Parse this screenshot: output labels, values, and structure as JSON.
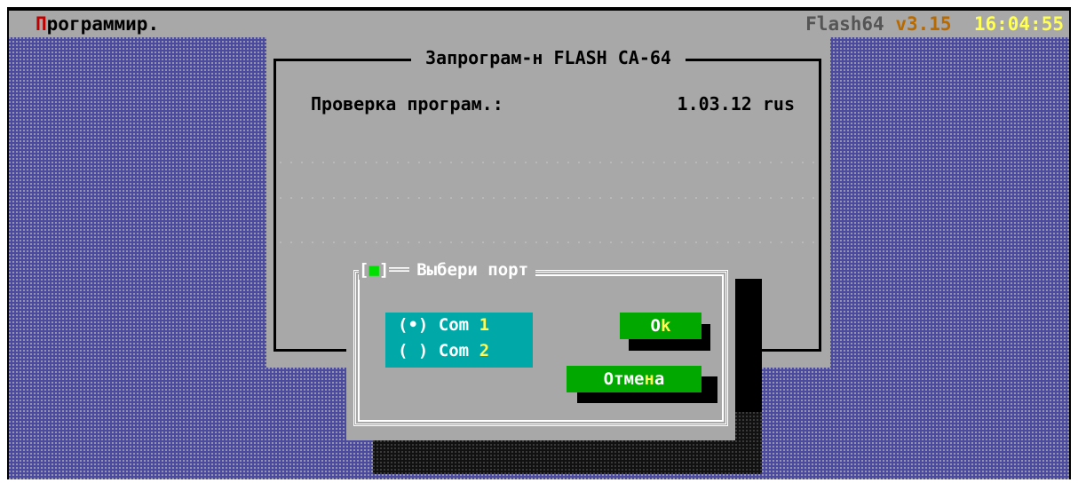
{
  "menubar": {
    "app_menu_hotkey": "П",
    "app_menu_rest": "рограммир.",
    "program_name": "Flash64",
    "version": "v3.15",
    "clock": "16:04:55"
  },
  "main_dialog": {
    "title": "Запрограм-н FLASH CA-64",
    "verify_label": "Проверка програм.:",
    "verify_value": "1.03.12 rus"
  },
  "port_dialog": {
    "close_open": "[",
    "close_mark": "■",
    "close_end": "]══",
    "title": "Выбери порт",
    "options": [
      {
        "marker": "(•)",
        "label": "Com",
        "number": "1",
        "selected": true
      },
      {
        "marker": "( )",
        "label": "Com",
        "number": "2",
        "selected": false
      }
    ],
    "ok": {
      "pre": "O",
      "hotkey": "k",
      "post": ""
    },
    "cancel": {
      "pre": "Отме",
      "hotkey": "н",
      "post": "а"
    }
  },
  "colors": {
    "desktop": "#4a4aa0",
    "dialog": "#a8a8a8",
    "radio_bg": "#00a8a8",
    "button_bg": "#00a800",
    "hotkey": "#ffff55",
    "menu_hotkey": "#c00000"
  }
}
